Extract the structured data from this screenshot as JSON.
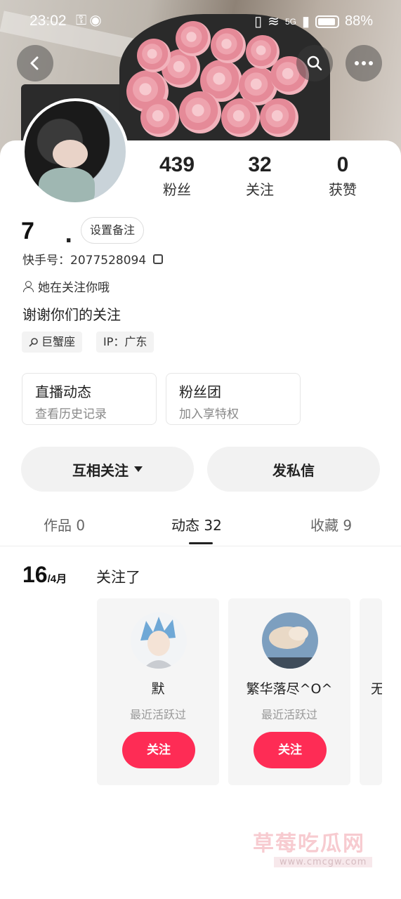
{
  "status_bar": {
    "time": "23:02",
    "battery": "88%",
    "network": "5G"
  },
  "nav": {
    "back_icon": "chevron-left-icon",
    "search_icon": "search-icon",
    "more_icon": "more-icon"
  },
  "profile": {
    "name": "7",
    "name_suffix": ".",
    "remark_button": "设置备注",
    "kuaishou_id": "快手号：2077528094",
    "follow_hint": "她在关注你哦",
    "bio": "谢谢你们的关注",
    "tags": [
      "巨蟹座",
      "IP：广东"
    ],
    "stats": [
      {
        "num": "439",
        "label": "粉丝"
      },
      {
        "num": "32",
        "label": "关注"
      },
      {
        "num": "0",
        "label": "获赞"
      }
    ]
  },
  "entries": [
    {
      "title": "直播动态",
      "subtitle": "查看历史记录"
    },
    {
      "title": "粉丝团",
      "subtitle": "加入享特权"
    }
  ],
  "actions": {
    "mutual_follow": "互相关注",
    "message": "发私信"
  },
  "tabs": [
    {
      "label": "作品 0"
    },
    {
      "label": "动态 32"
    },
    {
      "label": "收藏 9"
    }
  ],
  "feed": {
    "day": "16",
    "month": "/4月",
    "title": "关注了",
    "users": [
      {
        "name": "默",
        "subtitle": "最近活跃过",
        "button": "关注"
      },
      {
        "name": "繁华落尽^O^",
        "subtitle": "最近活跃过",
        "button": "关注"
      },
      {
        "name": "无"
      }
    ]
  },
  "watermark": {
    "text": "草莓吃瓜网",
    "sub": "www.cmcgw.com"
  },
  "colors": {
    "accent": "#fe2c55"
  }
}
